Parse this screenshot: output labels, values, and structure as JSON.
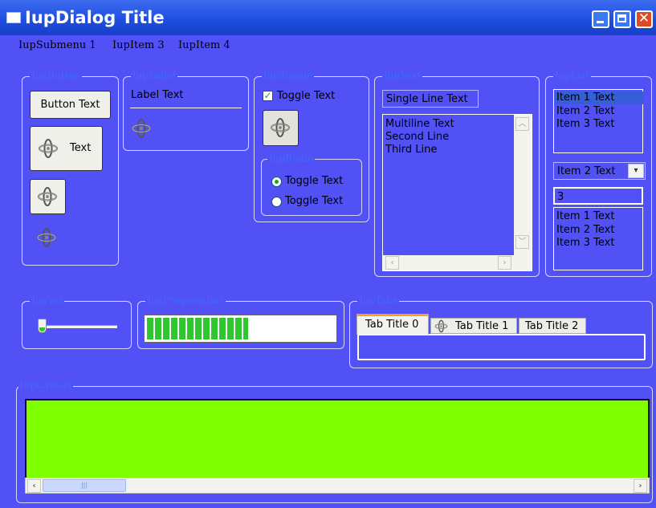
{
  "window": {
    "title": "IupDialog Title"
  },
  "menu": [
    "IupSubmenu 1",
    "IupItem 3",
    "IupItem 4"
  ],
  "frames": {
    "button": "IupButton",
    "label": "IupLabel",
    "toggle": "IupToggle",
    "radio": "IupRadio",
    "text": "IupText",
    "list": "IupList",
    "val": "IupVal",
    "progress": "IupProgressBar",
    "tabs": "IupTabs",
    "canvas": "IupCanvas"
  },
  "buttons": {
    "button_text": "Button Text",
    "image_text": "Text"
  },
  "label": {
    "text": "Label Text"
  },
  "toggle": {
    "label": "Toggle Text",
    "checked": true
  },
  "radio": {
    "options": [
      {
        "label": "Toggle Text",
        "selected": true
      },
      {
        "label": "Toggle Text",
        "selected": false
      }
    ]
  },
  "text": {
    "single_line": "Single Line Text",
    "multiline": [
      "Multiline Text",
      "Second Line",
      "Third Line"
    ]
  },
  "list": {
    "list1_items": [
      "Item 1 Text",
      "Item 2 Text",
      "Item 3 Text"
    ],
    "list1_selected": 0,
    "dropdown_value": "Item 2 Text",
    "edit_value": "3",
    "list2_items": [
      "Item 1 Text",
      "Item 2 Text",
      "Item 3 Text"
    ]
  },
  "val": {
    "value": 0
  },
  "progress": {
    "value": 0.54
  },
  "tabs": {
    "items": [
      "Tab Title 0",
      "Tab Title 1",
      "Tab Title 2"
    ],
    "active": 0
  },
  "canvas": {
    "color": "#7fff00"
  },
  "colors": {
    "window_bg": "#5151f5",
    "legend": "#3b6bff",
    "progress_fill": "#2fc62f"
  },
  "icons": {
    "image": "gimbal-icon"
  }
}
